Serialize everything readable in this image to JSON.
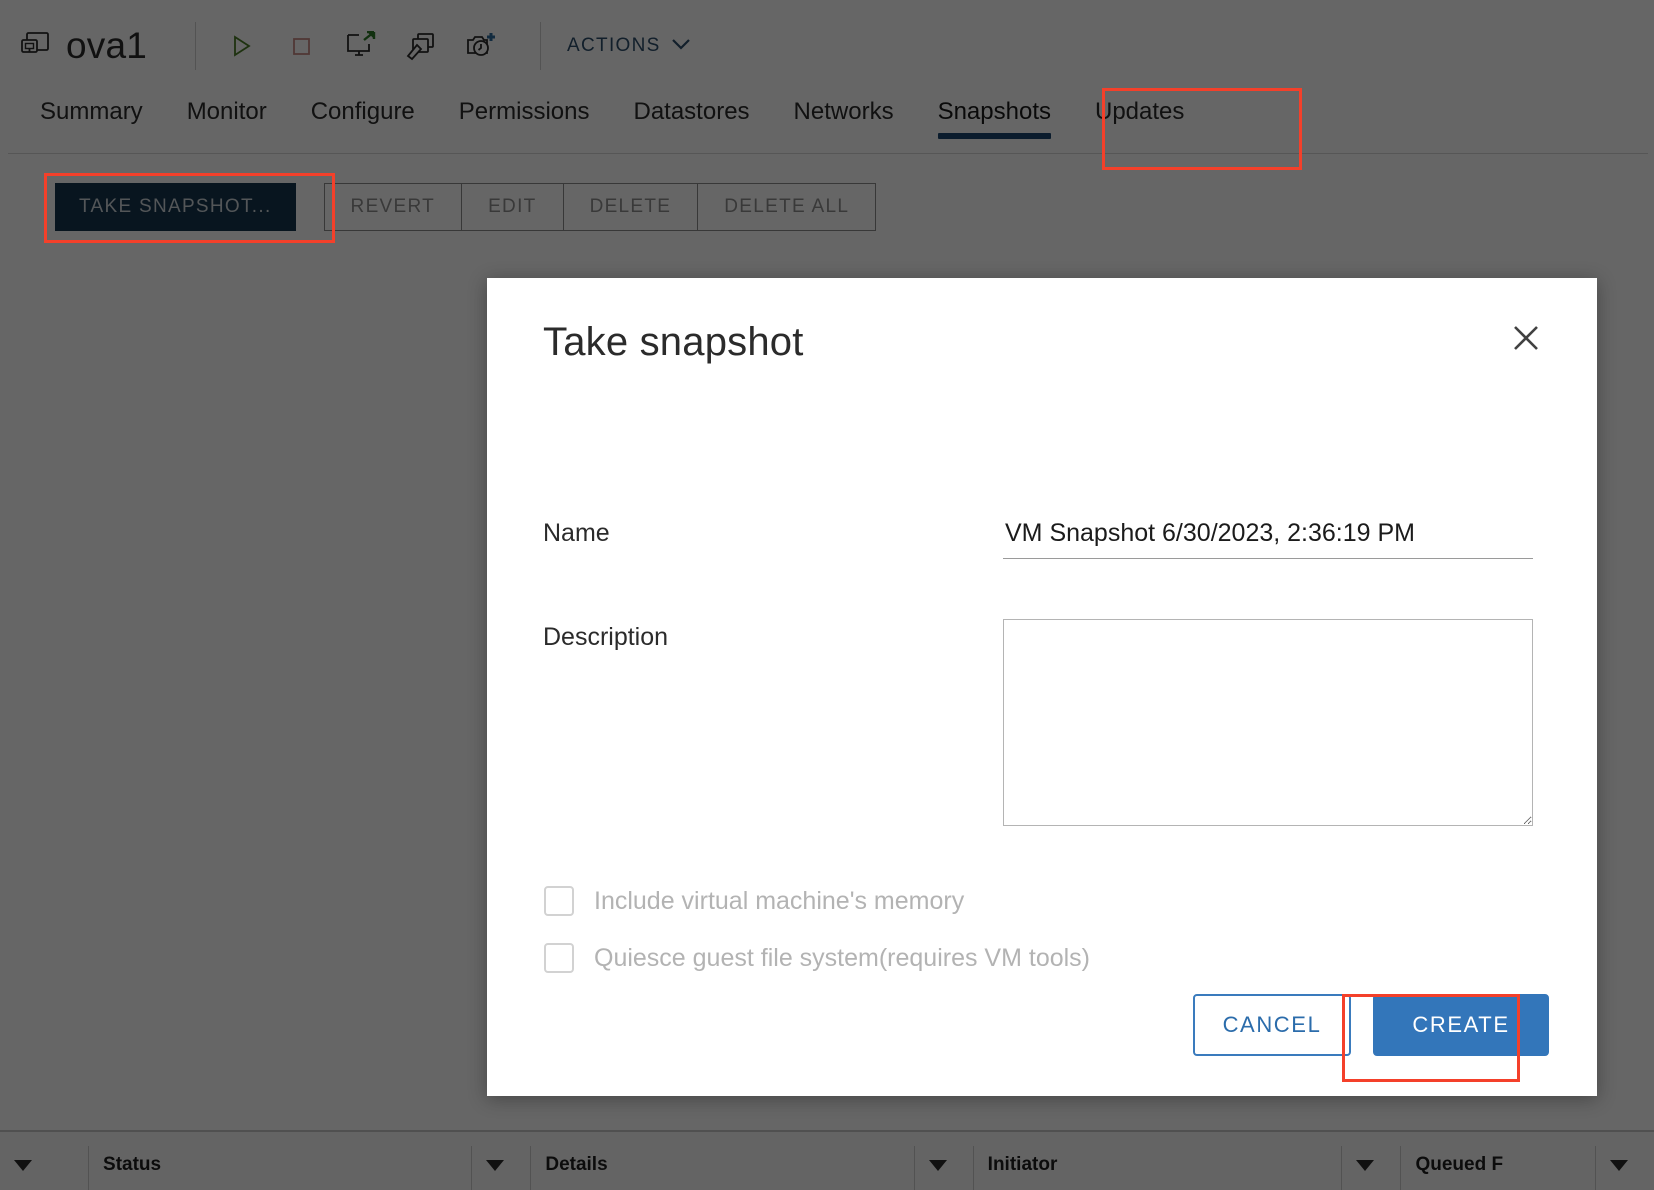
{
  "header": {
    "vm_icon": "virtual-machine-icon",
    "vm_name": "ova1",
    "toolbar_icons": [
      {
        "name": "power-on-icon",
        "title": "Power On"
      },
      {
        "name": "power-off-icon",
        "title": "Power Off"
      },
      {
        "name": "launch-console-icon",
        "title": "Launch Web Console"
      },
      {
        "name": "migrate-vm-icon",
        "title": "Migrate"
      },
      {
        "name": "take-snapshot-icon",
        "title": "Take Snapshot"
      }
    ],
    "actions_label": "ACTIONS",
    "actions_caret": "chevron-down-icon"
  },
  "tabs": [
    {
      "label": "Summary",
      "active": false
    },
    {
      "label": "Monitor",
      "active": false
    },
    {
      "label": "Configure",
      "active": false
    },
    {
      "label": "Permissions",
      "active": false
    },
    {
      "label": "Datastores",
      "active": false
    },
    {
      "label": "Networks",
      "active": false
    },
    {
      "label": "Snapshots",
      "active": true
    },
    {
      "label": "Updates",
      "active": false
    }
  ],
  "snapshot_toolbar": {
    "take_snapshot": "TAKE SNAPSHOT...",
    "revert": "REVERT",
    "edit": "EDIT",
    "delete": "DELETE",
    "delete_all": "DELETE ALL"
  },
  "dialog": {
    "title": "Take snapshot",
    "close_icon": "close-icon",
    "name_label": "Name",
    "name_value": "VM Snapshot 6/30/2023, 2:36:19 PM",
    "description_label": "Description",
    "description_value": "",
    "description_placeholder": "",
    "memory_checkbox_label": "Include virtual machine's memory",
    "memory_checked": false,
    "quiesce_checkbox_label": "Quiesce guest file system(requires VM tools)",
    "quiesce_checked": false,
    "cancel_label": "CANCEL",
    "create_label": "CREATE"
  },
  "task_pane": {
    "columns": [
      {
        "label": "Status"
      },
      {
        "label": "Details"
      },
      {
        "label": "Initiator"
      },
      {
        "label": "Queued F"
      }
    ]
  },
  "colors": {
    "accent_blue": "#3376ba",
    "dark_blue": "#16364f",
    "tab_underline": "#1d4770",
    "annotation_red": "#f4402a",
    "actions_text": "#2d4f6b"
  }
}
